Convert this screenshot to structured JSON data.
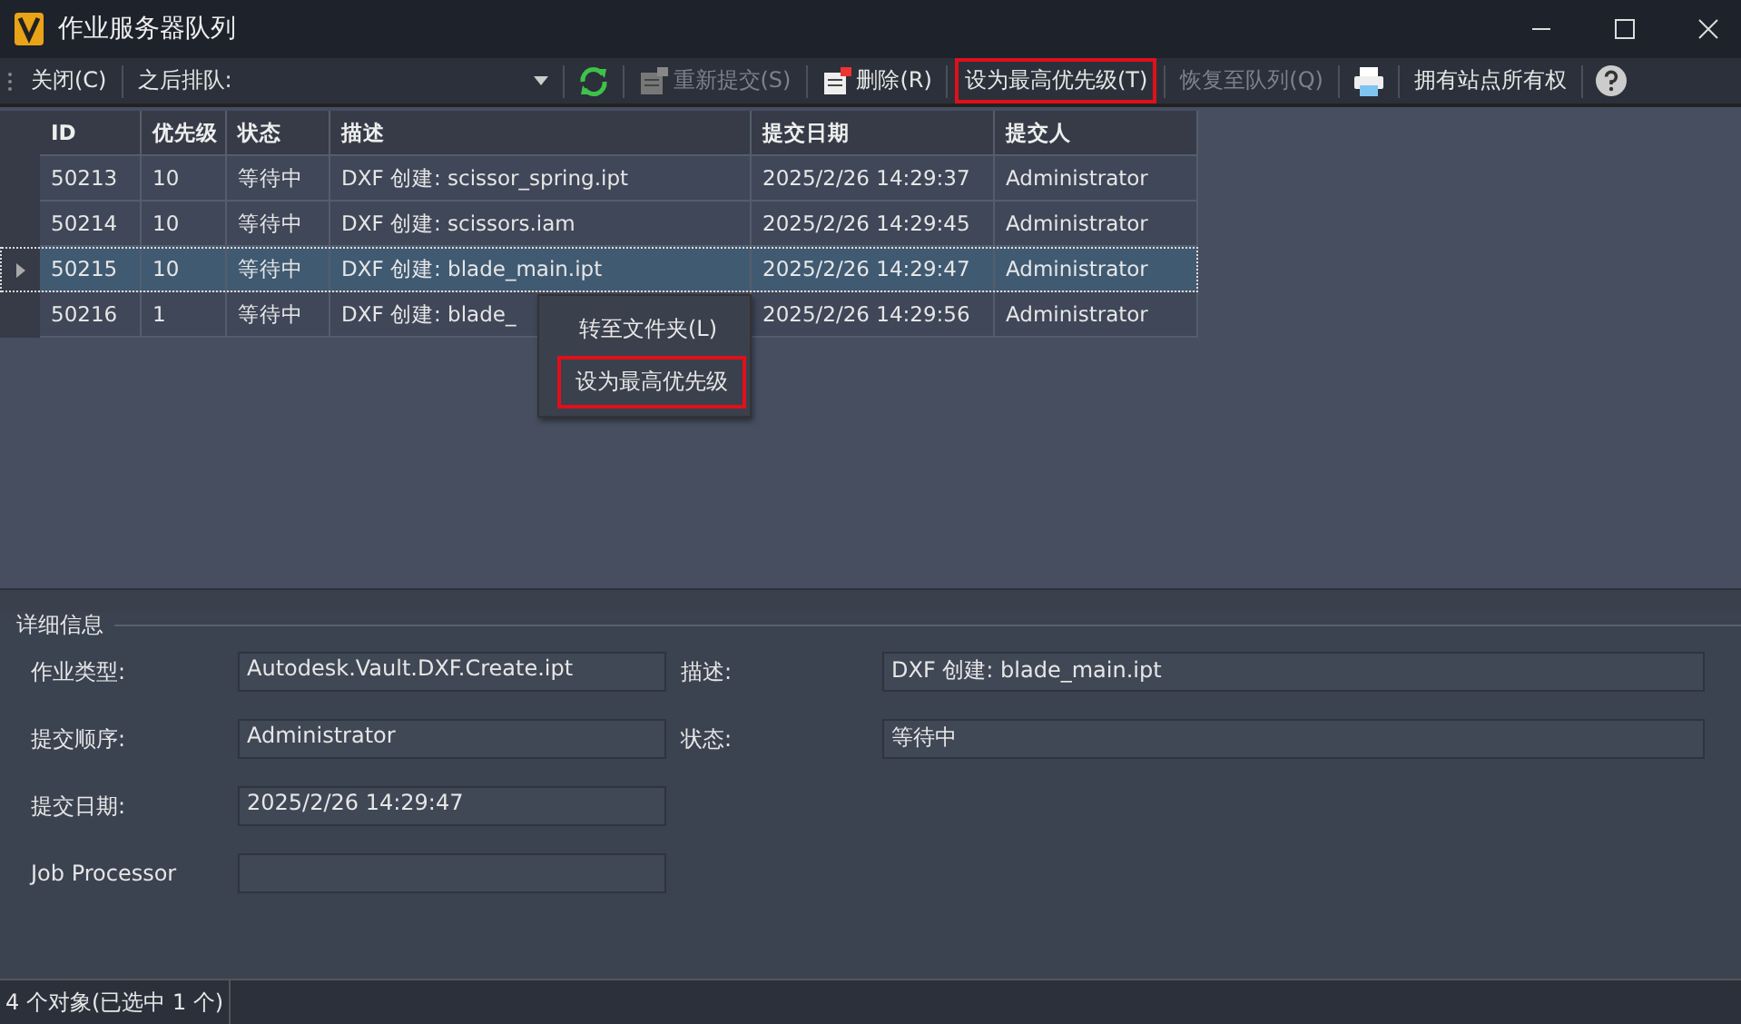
{
  "window": {
    "title": "作业服务器队列"
  },
  "toolbar": [
    {
      "kind": "button",
      "label": "关闭(C)",
      "disabled": false,
      "highlighted": false
    },
    {
      "kind": "dropdown",
      "label": "之后排队:"
    },
    {
      "kind": "refresh",
      "disabled": false
    },
    {
      "kind": "docbutton",
      "label": "重新提交(S)",
      "disabled": true,
      "highlighted": false
    },
    {
      "kind": "docbutton",
      "label": "删除(R)",
      "disabled": false,
      "highlighted": false
    },
    {
      "kind": "button",
      "label": "设为最高优先级(T)",
      "disabled": false,
      "highlighted": true
    },
    {
      "kind": "button",
      "label": "恢复至队列(Q)",
      "disabled": true,
      "highlighted": false
    },
    {
      "kind": "print",
      "disabled": false
    },
    {
      "kind": "button",
      "label": "拥有站点所有权",
      "disabled": false,
      "highlighted": false
    },
    {
      "kind": "help",
      "disabled": false
    }
  ],
  "table": {
    "columns": [
      "ID",
      "优先级",
      "状态",
      "描述",
      "提交日期",
      "提交人"
    ],
    "rows": [
      {
        "selected": false,
        "cells": [
          "50213",
          "10",
          "等待中",
          "DXF 创建: scissor_spring.ipt",
          "2025/2/26 14:29:37",
          "Administrator"
        ]
      },
      {
        "selected": false,
        "cells": [
          "50214",
          "10",
          "等待中",
          "DXF 创建: scissors.iam",
          "2025/2/26 14:29:45",
          "Administrator"
        ]
      },
      {
        "selected": true,
        "cells": [
          "50215",
          "10",
          "等待中",
          "DXF 创建: blade_main.ipt",
          "2025/2/26 14:29:47",
          "Administrator"
        ]
      },
      {
        "selected": false,
        "cells": [
          "50216",
          "1",
          "等待中",
          "DXF 创建: blade_",
          "2025/2/26 14:29:56",
          "Administrator"
        ]
      }
    ]
  },
  "context_menu": [
    {
      "label": "转至文件夹(L)",
      "highlighted": false
    },
    {
      "label": "设为最高优先级",
      "highlighted": true
    }
  ],
  "details": {
    "title": "详细信息",
    "left": [
      {
        "label": "作业类型:",
        "value": "Autodesk.Vault.DXF.Create.ipt"
      },
      {
        "label": "提交顺序:",
        "value": "Administrator"
      },
      {
        "label": "提交日期:",
        "value": "2025/2/26 14:29:47"
      },
      {
        "label": "Job Processor"
      }
    ],
    "right": [
      {
        "label": "描述:",
        "value": "DXF 创建: blade_main.ipt"
      },
      {
        "label": "状态:",
        "value": "等待中"
      }
    ]
  },
  "status_bar": {
    "text": "4 个对象(已选中 1 个)"
  }
}
